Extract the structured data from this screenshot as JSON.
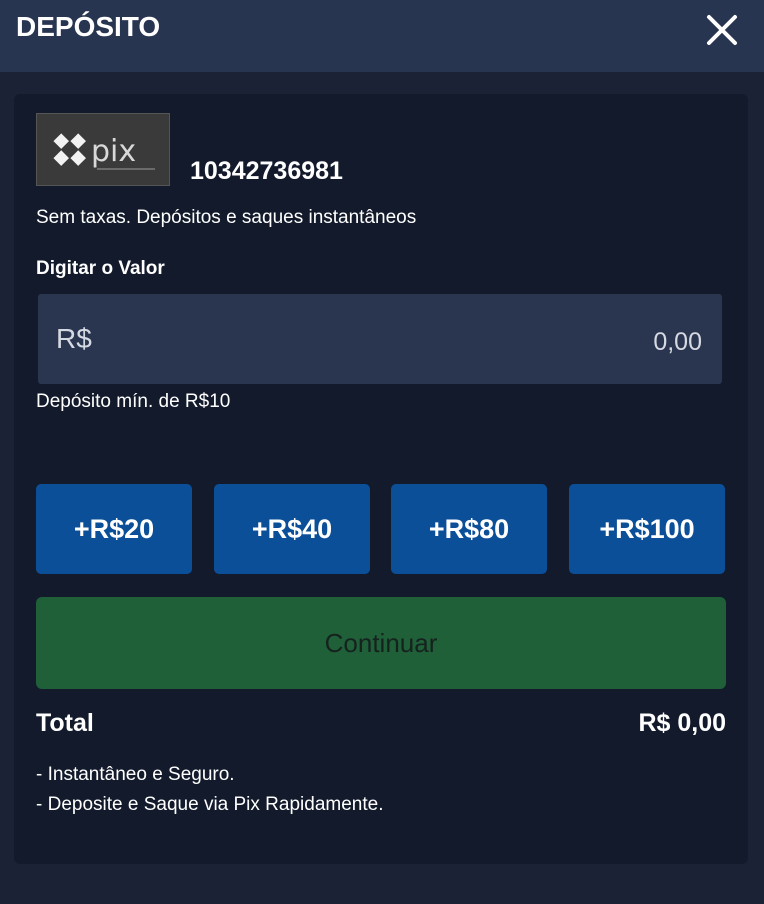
{
  "header": {
    "title": "DEPÓSITO",
    "close_icon": "close-icon"
  },
  "payment": {
    "logo_icon": "pix-logo",
    "logo_text": "pix",
    "account_number": "10342736981",
    "fee_text": "Sem taxas. Depósitos e saques instantâneos"
  },
  "amount": {
    "label": "Digitar o Valor",
    "currency_prefix": "R$",
    "value": "0,00",
    "min_text": "Depósito mín. de R$10"
  },
  "quick_amounts": [
    "+R$20",
    "+R$40",
    "+R$80",
    "+R$100"
  ],
  "continue_label": "Continuar",
  "total": {
    "label": "Total",
    "value": "R$ 0,00"
  },
  "notes": [
    "- Instantâneo e Seguro.",
    "- Deposite e Saque via Pix Rapidamente."
  ],
  "colors": {
    "background": "#1b2236",
    "header": "#283551",
    "panel": "#121a2b",
    "input": "#2a3550",
    "quick_button": "#0c4f99",
    "continue_button": "#1f6039"
  }
}
